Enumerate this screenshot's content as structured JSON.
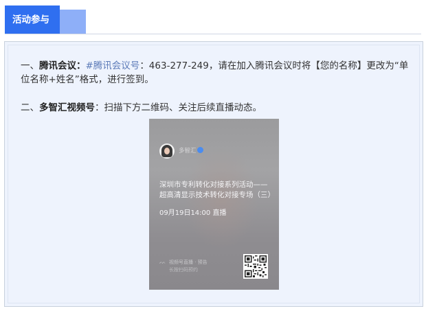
{
  "header": {
    "tab_label": "活动参与"
  },
  "content": {
    "p1": {
      "prefix": "一、",
      "bold": "腾讯会议：",
      "meeting_label": "#腾讯会议号",
      "text": "：463-277-249，请在加入腾讯会议时将【您的名称】更改为“单位名称+姓名”格式，进行签到。"
    },
    "p2": {
      "prefix": "二、",
      "bold": "多智汇视频号",
      "text": "：扫描下方二维码、关注后续直播动态。"
    }
  },
  "poster": {
    "account_name": "多智汇",
    "title": "深圳市专利转化对接系列活动——超高清显示技术转化对接专场（三）",
    "time": "09月19日14:00 直播",
    "footer_line1": "视频号直播 · 预告",
    "footer_line2": "长按扫码预约",
    "qr_icon": "qr-code-icon",
    "channel_icon": "channels-icon"
  }
}
